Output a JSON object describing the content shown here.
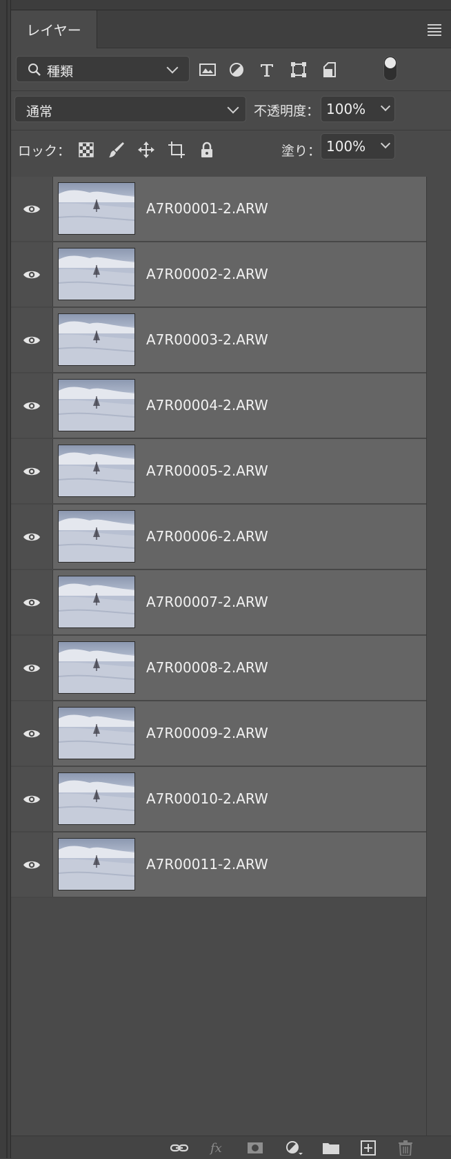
{
  "panel": {
    "tab_label": "レイヤー",
    "filter_label": "種類",
    "blend_mode": "通常",
    "opacity_label": "不透明度：",
    "opacity_value": "100%",
    "lock_label": "ロック：",
    "fill_label": "塗り：",
    "fill_value": "100%"
  },
  "filter_icons": [
    "image-filter-icon",
    "adjustment-filter-icon",
    "type-filter-icon",
    "shape-filter-icon",
    "smart-object-filter-icon"
  ],
  "lock_icons": [
    "lock-transparent-pixels-icon",
    "lock-image-pixels-icon",
    "lock-position-icon",
    "lock-artboard-icon",
    "lock-all-icon"
  ],
  "layers": [
    {
      "name": "A7R00001-2.ARW"
    },
    {
      "name": "A7R00002-2.ARW"
    },
    {
      "name": "A7R00003-2.ARW"
    },
    {
      "name": "A7R00004-2.ARW"
    },
    {
      "name": "A7R00005-2.ARW"
    },
    {
      "name": "A7R00006-2.ARW"
    },
    {
      "name": "A7R00007-2.ARW"
    },
    {
      "name": "A7R00008-2.ARW"
    },
    {
      "name": "A7R00009-2.ARW"
    },
    {
      "name": "A7R00010-2.ARW"
    },
    {
      "name": "A7R00011-2.ARW"
    }
  ],
  "bottom_icons": [
    "link-layers-icon",
    "fx-icon",
    "add-mask-icon",
    "new-adjustment-layer-icon",
    "new-group-icon",
    "new-layer-icon",
    "delete-layer-icon"
  ],
  "colors": {
    "panel_bg": "#4a4a4a",
    "layer_row_bg": "#656565"
  }
}
